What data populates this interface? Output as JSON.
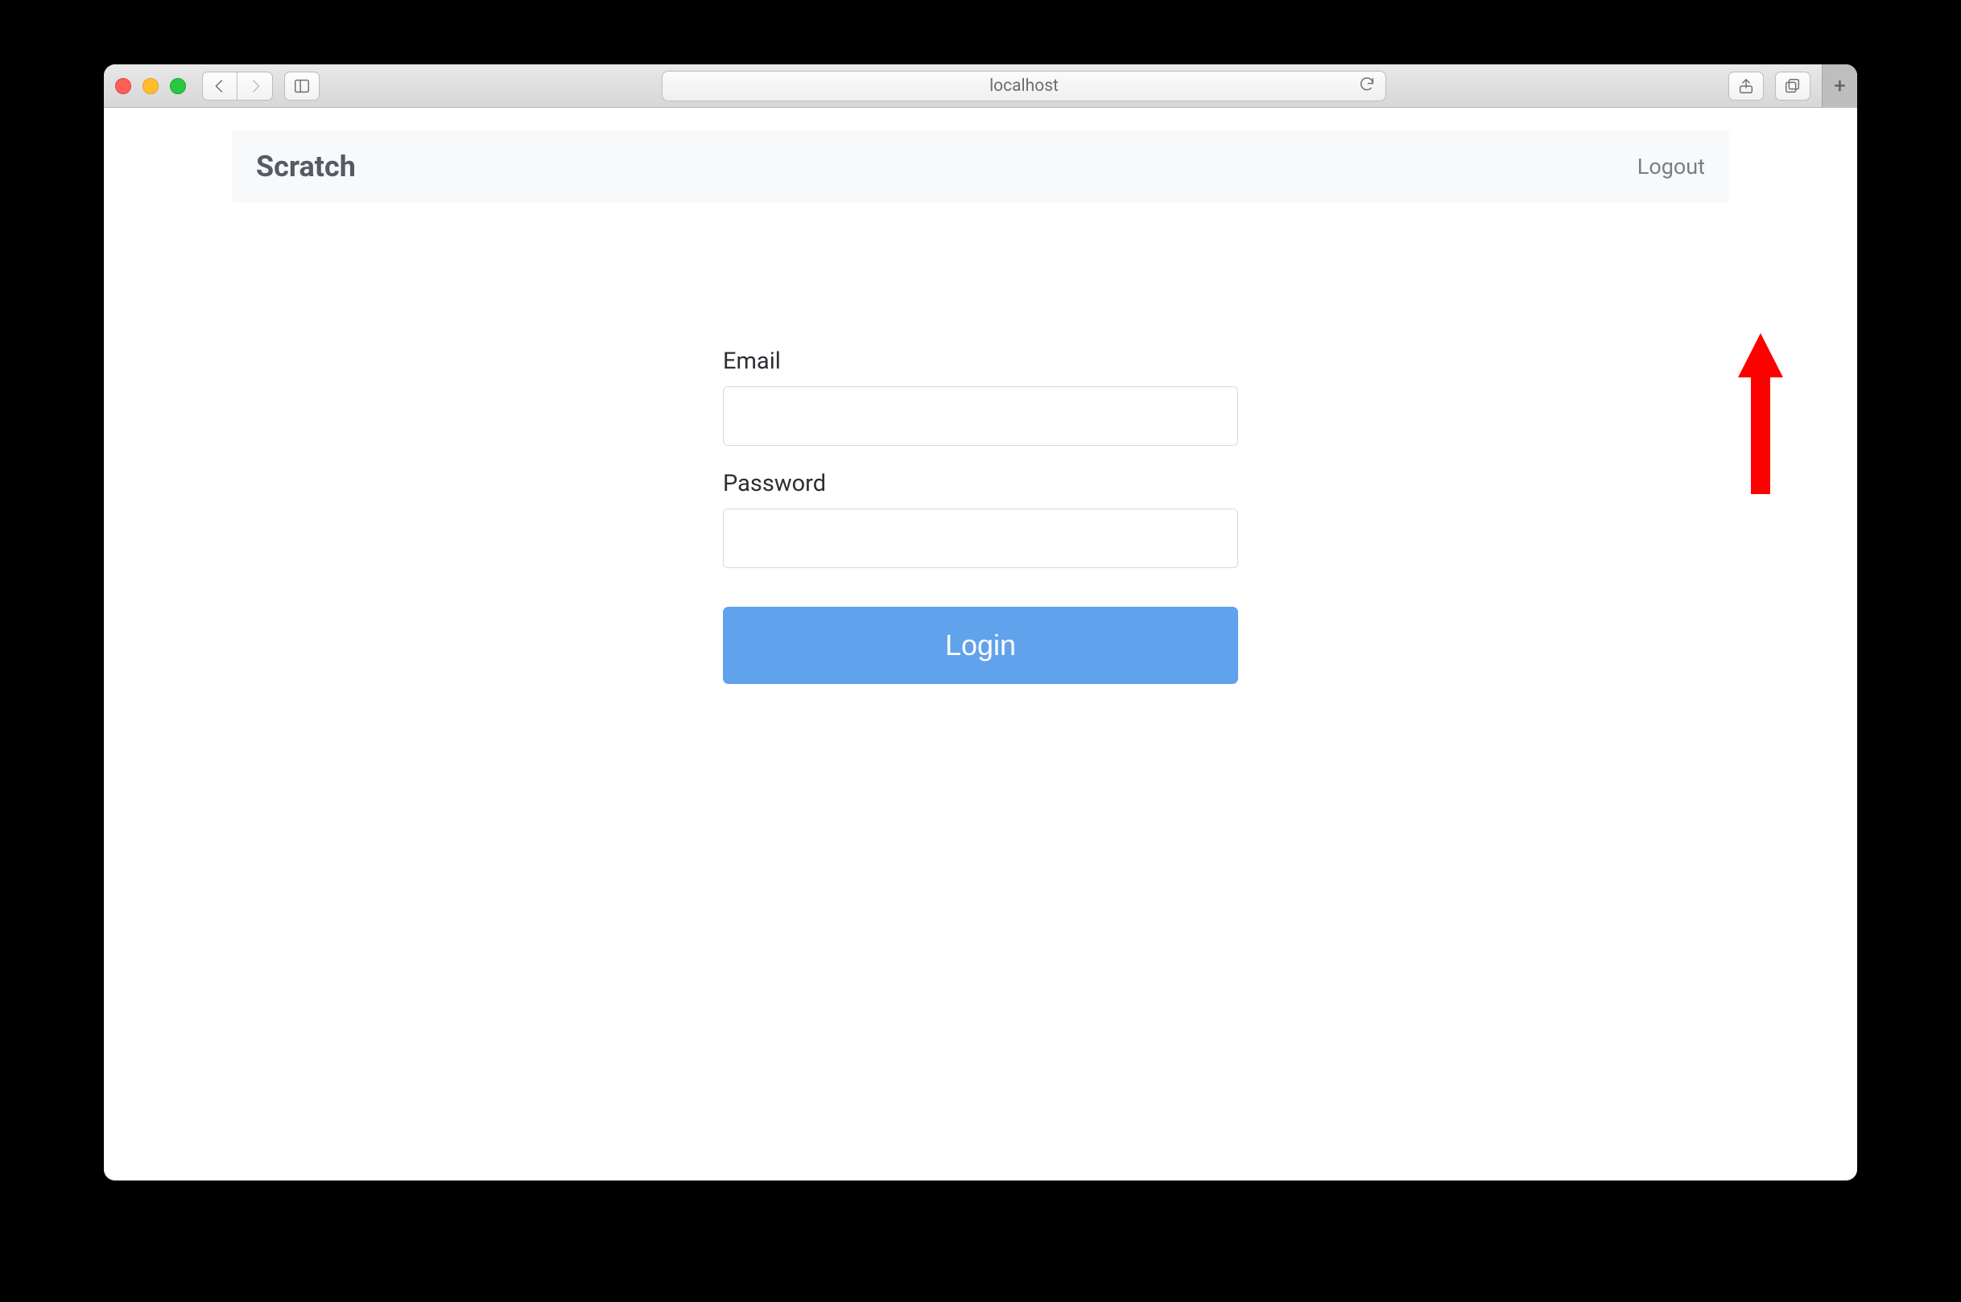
{
  "browser": {
    "address": "localhost"
  },
  "navbar": {
    "brand": "Scratch",
    "logout": "Logout"
  },
  "form": {
    "email_label": "Email",
    "email_value": "",
    "password_label": "Password",
    "password_value": "",
    "login_button": "Login"
  }
}
